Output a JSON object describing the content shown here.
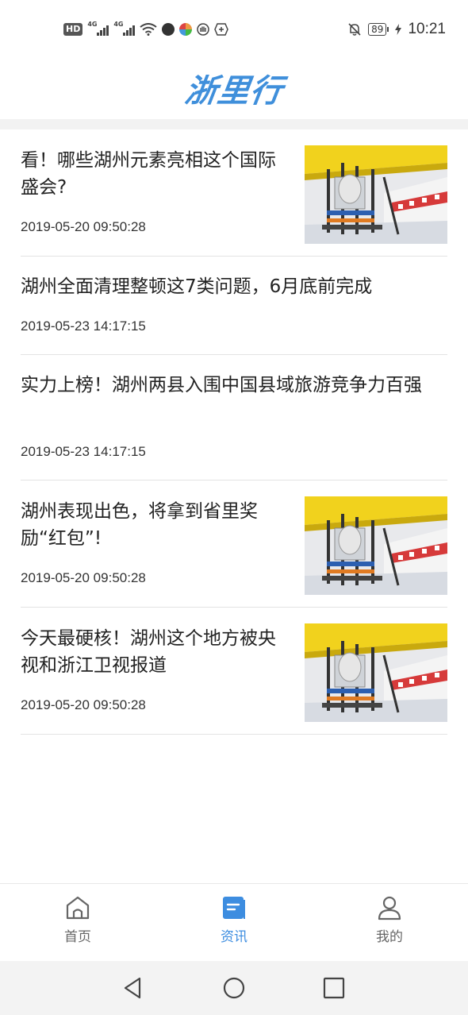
{
  "status_bar": {
    "hd_label": "HD",
    "sim1_label": "4G",
    "sim2_label": "4G",
    "battery_level": "89",
    "time": "10:21"
  },
  "header": {
    "logo_text": "浙里行",
    "logo_color": "#3f8fdb"
  },
  "news": [
    {
      "title": "看！哪些湖州元素亮相这个国际盛会?",
      "date": "2019-05-20 09:50:28",
      "has_thumb": true
    },
    {
      "title": "湖州全面清理整顿这7类问题，6月底前完成",
      "date": "2019-05-23 14:17:15",
      "has_thumb": false
    },
    {
      "title": "实力上榜！湖州两县入围中国县域旅游竞争力百强",
      "date": "2019-05-23 14:17:15",
      "has_thumb": false
    },
    {
      "title": "湖州表现出色，将拿到省里奖励“红包”!",
      "date": "2019-05-20 09:50:28",
      "has_thumb": true
    },
    {
      "title": "今天最硬核！湖州这个地方被央视和浙江卫视报道",
      "date": "2019-05-20 09:50:28",
      "has_thumb": true
    }
  ],
  "bottom_nav": {
    "items": [
      {
        "label": "首页",
        "icon": "home-icon",
        "active": false
      },
      {
        "label": "资讯",
        "icon": "news-icon",
        "active": true
      },
      {
        "label": "我的",
        "icon": "person-icon",
        "active": false
      }
    ],
    "active_color": "#3d8de0"
  },
  "system_nav": {
    "icons": [
      "back-icon",
      "home-circle-icon",
      "recents-icon"
    ]
  }
}
